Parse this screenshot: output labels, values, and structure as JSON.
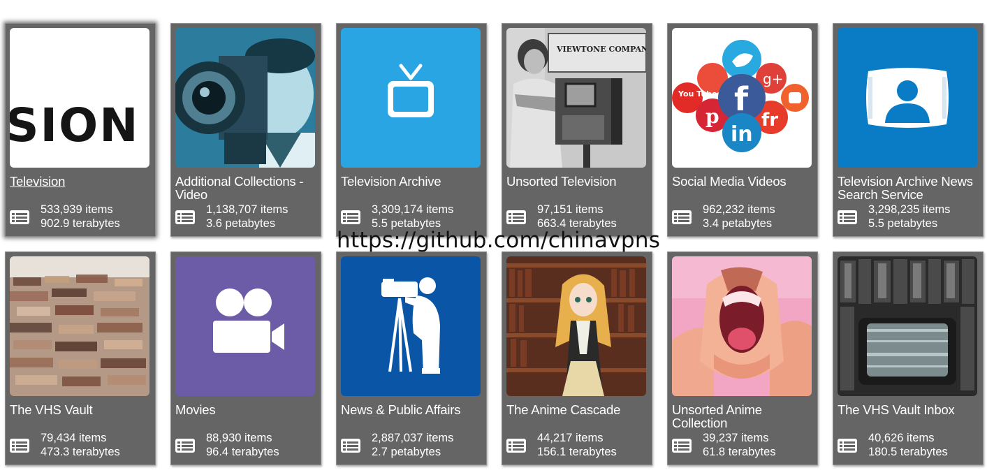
{
  "collections": [
    {
      "title": "Television",
      "items": "533,939 items",
      "size": "902.9 terabytes",
      "thumb_text": "SION",
      "icon": "text-logo-thumb"
    },
    {
      "title": "Additional Collections - Video",
      "items": "1,138,707 items",
      "size": "3.6 petabytes",
      "icon": "cameraman-photo-thumb"
    },
    {
      "title": "Television Archive",
      "items": "3,309,174 items",
      "size": "5.5 petabytes",
      "icon": "tv-icon",
      "color": "#29a5e3"
    },
    {
      "title": "Unsorted Television",
      "items": "97,151 items",
      "size": "663.4 terabytes",
      "thumb_text": "VIEWTONE COMPANY TELEVISION",
      "icon": "vintage-tv-photo-thumb"
    },
    {
      "title": "Social Media Videos",
      "items": "962,232 items",
      "size": "3.4 petabytes",
      "thumb_text": "You Tube",
      "icon": "social-media-logos-thumb"
    },
    {
      "title": "Television Archive News Search Service",
      "items": "3,298,235 items",
      "size": "5.5 petabytes",
      "icon": "tv-person-icon",
      "color": "#0a7cc5"
    },
    {
      "title": "The VHS Vault",
      "items": "79,434 items",
      "size": "473.3 terabytes",
      "icon": "vhs-pile-photo-thumb"
    },
    {
      "title": "Movies",
      "items": "88,930 items",
      "size": "96.4 terabytes",
      "icon": "movie-camera-icon",
      "color": "#6c5ca8"
    },
    {
      "title": "News & Public Affairs",
      "items": "2,887,037 items",
      "size": "2.7 petabytes",
      "icon": "cameraman-silhouette-icon",
      "color": "#0a55a5"
    },
    {
      "title": "The Anime Cascade",
      "items": "44,217 items",
      "size": "156.1 terabytes",
      "icon": "anime-library-thumb"
    },
    {
      "title": "Unsorted Anime Collection",
      "items": "39,237 items",
      "size": "61.8 terabytes",
      "icon": "anime-shout-thumb"
    },
    {
      "title": "The VHS Vault Inbox",
      "items": "40,626 items",
      "size": "180.5 terabytes",
      "icon": "vhs-tv-photo-thumb"
    }
  ],
  "stats_icon": "list-icon",
  "card_color": "#656565",
  "watermark": "https://github.com/chinavpns"
}
